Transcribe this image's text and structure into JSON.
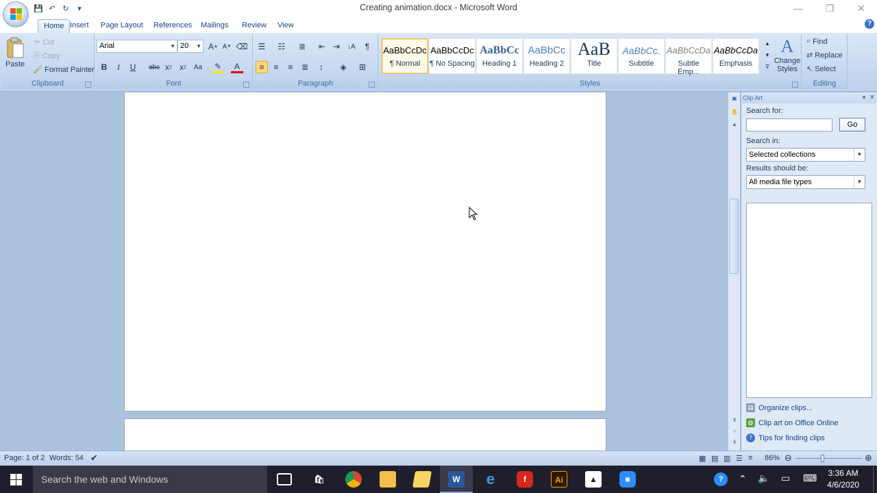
{
  "window": {
    "title": "Creating animation.docx - Microsoft Word",
    "controls": {
      "minimize": "—",
      "restore": "❐",
      "close": "✕"
    }
  },
  "qat": {
    "save": "💾",
    "undo": "↶",
    "redo": "↻",
    "customize": "▾"
  },
  "tabs": [
    "Home",
    "Insert",
    "Page Layout",
    "References",
    "Mailings",
    "Review",
    "View"
  ],
  "help": "?",
  "ribbon": {
    "clipboard": {
      "label": "Clipboard",
      "paste": "Paste",
      "cut": "Cut",
      "copy": "Copy",
      "format_painter": "Format Painter"
    },
    "font": {
      "label": "Font",
      "font_name": "Arial",
      "font_size": "20"
    },
    "paragraph": {
      "label": "Paragraph"
    },
    "styles": {
      "label": "Styles",
      "items": [
        {
          "sample": "AaBbCcDc",
          "name": "¶ Normal"
        },
        {
          "sample": "AaBbCcDc",
          "name": "¶ No Spacing"
        },
        {
          "sample": "AaBbCc",
          "name": "Heading 1"
        },
        {
          "sample": "AaBbCc",
          "name": "Heading 2"
        },
        {
          "sample": "AaB",
          "name": "Title"
        },
        {
          "sample": "AaBbCc.",
          "name": "Subtitle"
        },
        {
          "sample": "AaBbCcDa",
          "name": "Subtle Emp..."
        },
        {
          "sample": "AaBbCcDa",
          "name": "Emphasis"
        }
      ],
      "change_styles": "Change Styles"
    },
    "editing": {
      "label": "Editing",
      "find": "Find",
      "replace": "Replace",
      "select": "Select"
    }
  },
  "clip_art": {
    "title": "Clip Art",
    "search_for_label": "Search for:",
    "search_value": "",
    "go_label": "Go",
    "search_in_label": "Search in:",
    "search_in_value": "Selected collections",
    "results_label": "Results should be:",
    "results_value": "All media file types",
    "links": [
      "Organize clips...",
      "Clip art on Office Online",
      "Tips for finding clips"
    ]
  },
  "status": {
    "page": "Page: 1 of 2",
    "words": "Words: 54",
    "zoom": "86%"
  },
  "taskbar": {
    "search_placeholder": "Search the web and Windows",
    "time": "3:36 AM",
    "date": "4/6/2020"
  },
  "colors": {
    "ribbon": "#c5d7ee",
    "doc_bg": "#abc2dd",
    "accent": "#15428b",
    "taskbar": "#1f1f2b"
  }
}
